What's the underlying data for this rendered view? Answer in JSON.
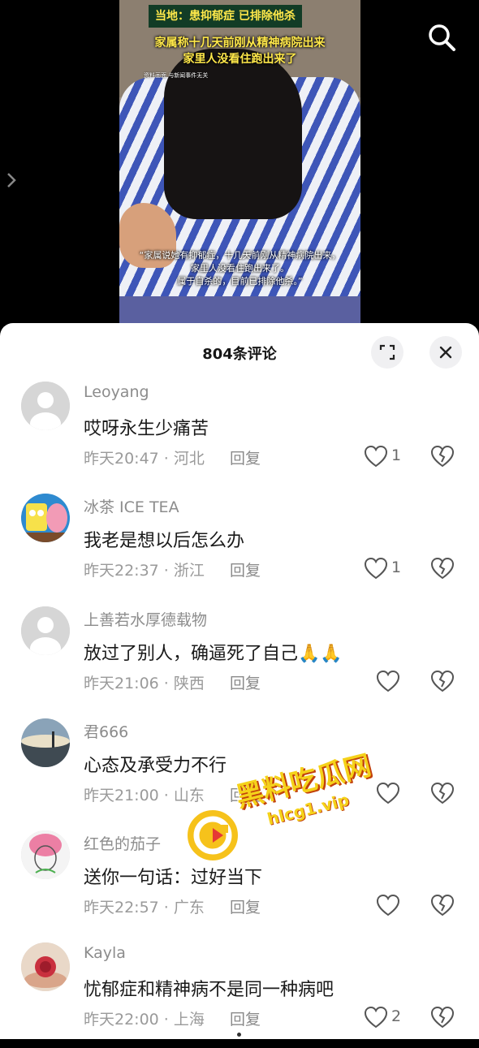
{
  "video": {
    "tag": "当地：患抑郁症 已排除他杀",
    "caption_line1": "家属称十几天前刚从精神病院出来",
    "caption_line2": "家里人没看住跑出来了",
    "tiny_note": "资料画面 与新闻事件无关",
    "subtitle_line1": "“家属说她有抑郁症，十几天前刚从精神病院出来，",
    "subtitle_line2": "家里人没看住跑出来了。",
    "subtitle_line3": "属于自杀的，目前已排除他杀。”"
  },
  "sheet": {
    "title": "804条评论"
  },
  "comments": [
    {
      "user": "Leoyang",
      "text": "哎呀永生少痛苦",
      "time": "昨天20:47",
      "location": "河北",
      "reply": "回复",
      "likes": "1",
      "avatar": "default-avatar"
    },
    {
      "user": "冰茶 ICE TEA",
      "text": "我老是想以后怎么办",
      "time": "昨天22:37",
      "location": "浙江",
      "reply": "回复",
      "likes": "1",
      "avatar": "cartoon-avatar"
    },
    {
      "user": "上善若水厚德载物",
      "text": "放过了别人，确逼死了自己",
      "emoji": "🙏🙏",
      "time": "昨天21:06",
      "location": "陕西",
      "reply": "回复",
      "likes": "",
      "avatar": "default-avatar"
    },
    {
      "user": "君666",
      "text": "心态及承受力不行",
      "time": "昨天21:00",
      "location": "山东",
      "reply": "回复",
      "likes": "",
      "avatar": "landscape-avatar"
    },
    {
      "user": "红色的茄子",
      "text": "送你一句话：过好当下",
      "time": "昨天22:57",
      "location": "广东",
      "reply": "回复",
      "likes": "",
      "avatar": "sketch-avatar"
    },
    {
      "user": "Kayla",
      "text": "忧郁症和精神病不是同一种病吧",
      "time": "昨天22:00",
      "location": "上海",
      "reply": "回复",
      "likes": "2",
      "avatar": "rose-avatar"
    }
  ],
  "watermark": {
    "line1": "黑料吃瓜网",
    "line2": "hlcg1.vip"
  },
  "icons": {
    "search": "search-icon",
    "expand": "expand-icon",
    "close": "close-icon",
    "like": "heart-icon",
    "dislike": "broken-heart-icon",
    "side": "chevron-right-icon"
  }
}
